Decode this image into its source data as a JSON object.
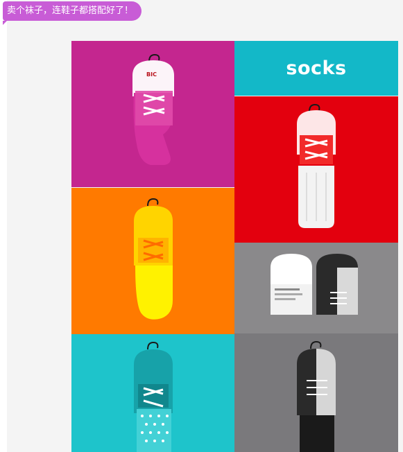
{
  "caption": {
    "text": "卖个袜子，连鞋子都搭配好了！"
  },
  "poster": {
    "title": "socks",
    "brand": "BIC",
    "colors": {
      "magenta": "#c4268f",
      "cyan": "#13b8c8",
      "red": "#e3000e",
      "orange": "#ff7a00",
      "gray": "#8a898b",
      "teal": "#1ec4cb",
      "darkgray": "#7a797c"
    }
  }
}
